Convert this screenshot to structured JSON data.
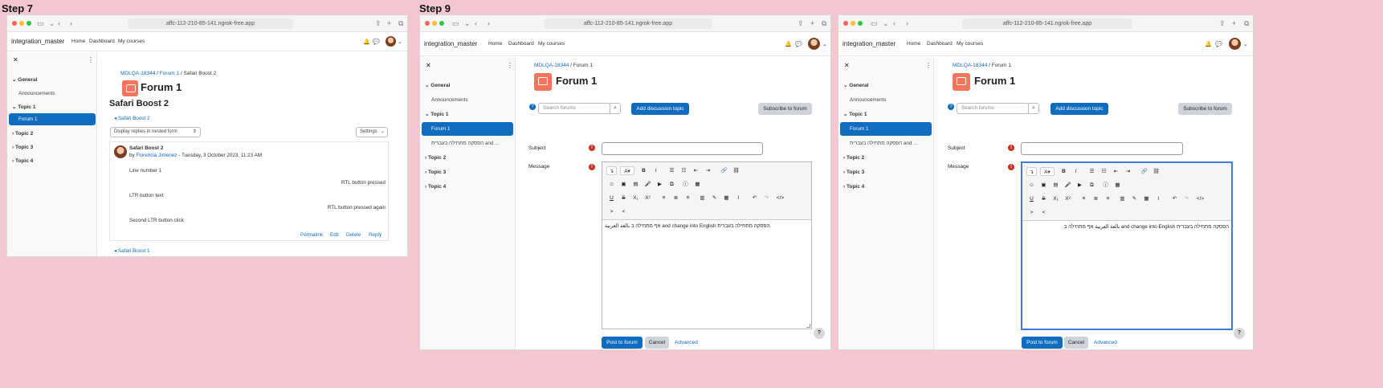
{
  "steps": {
    "step7": "Step 7",
    "step9": "Step 9"
  },
  "browser": {
    "url": "affc-112-210-85-141.ngrok-free.app"
  },
  "navbar": {
    "brand": "integration_master",
    "home": "Home",
    "dashboard": "Dashboard",
    "my_courses": "My courses"
  },
  "sidebar": {
    "general": "General",
    "announcements": "Announcements",
    "topic1": "Topic 1",
    "forum1": "Forum 1",
    "hebrew_item": "הפסקה מתחילה בעברית and ...",
    "topic2": "Topic 2",
    "topic3": "Topic 3",
    "topic4": "Topic 4"
  },
  "step7": {
    "breadcrumb": {
      "course": "MDLQA-18344",
      "sep": "/",
      "forum": "Forum 1",
      "discussion": "Safari Boost 2"
    },
    "forum_title": "Forum 1",
    "discussion_title": "Safari Boost 2",
    "back_link": "◂ Safari Boost 2",
    "display_mode": "Display replies in nested form",
    "settings": "Settings",
    "post": {
      "subject": "Safari Boost 2",
      "by": "by",
      "author": "Florencia Jiménez",
      "date": "- Tuesday, 3 October 2023, 11:23 AM",
      "line1": "Line number 1",
      "line2": "RTL button pressed",
      "line3": "LTR button text",
      "line4": "RTL button pressed again",
      "line5": "Second LTR button click",
      "actions": {
        "permalink": "Permalink",
        "edit": "Edit",
        "delete": "Delete",
        "reply": "Reply"
      }
    },
    "bottom_link": "◂ Safari Boost 1"
  },
  "step9": {
    "breadcrumb": {
      "course": "MDLQA-18344",
      "sep": "/",
      "forum": "Forum 1"
    },
    "forum_title": "Forum 1",
    "search_placeholder": "Search forums",
    "add_discussion": "Add discussion topic",
    "subscribe": "Subscribe to forum",
    "subject_label": "Subject",
    "message_label": "Message",
    "editor_text": "אף מתחילה ב بالغة العربية and change into English הפסקה מתחילה בעברית.",
    "editor_text_rtl": "הפסקה מתחילה בעברית and change into English بالغة العربية אף מתחילה ב",
    "post_button": "Post to forum",
    "cancel_button": "Cancel",
    "advanced_link": "Advanced",
    "help": "?"
  },
  "toolbar_icons": {
    "row1": [
      "↴",
      "A▾",
      "B",
      "I",
      "☰",
      "☷",
      "⇤",
      "⇥",
      "🔗",
      "⛓"
    ],
    "row2": [
      "☺",
      "▣",
      "▤",
      "🎤",
      "▶",
      "⧉",
      "ⓘ",
      "▦"
    ],
    "row3": [
      "U",
      "S",
      "X₁",
      "X²",
      "≡",
      "≣",
      "≡",
      "▥",
      "✎",
      "▦",
      "I",
      "↶",
      "↷",
      "</>"
    ],
    "row4": [
      ">",
      "<"
    ]
  },
  "colors": {
    "primary": "#0f6cbf",
    "background": "#f4c7d0",
    "forum_icon": "#f4755b",
    "required": "#ca3120"
  }
}
